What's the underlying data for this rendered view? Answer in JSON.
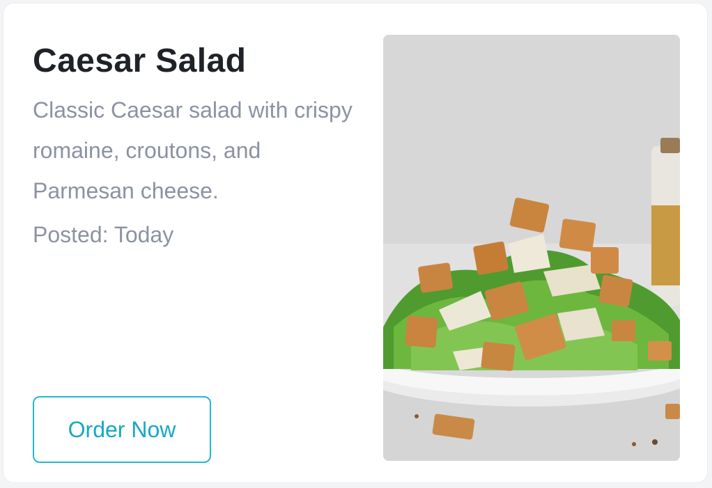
{
  "card": {
    "title": "Caesar Salad",
    "description": "Classic Caesar salad with crispy romaine, croutons, and Parmesan cheese.",
    "posted": "Posted: Today",
    "order_button_label": "Order Now"
  },
  "theme": {
    "accent_color": "#22b8cf",
    "title_color": "#1f2328",
    "muted_text_color": "#8b93a1",
    "background_color": "#ffffff"
  },
  "image": {
    "subject": "caesar-salad-photo"
  }
}
